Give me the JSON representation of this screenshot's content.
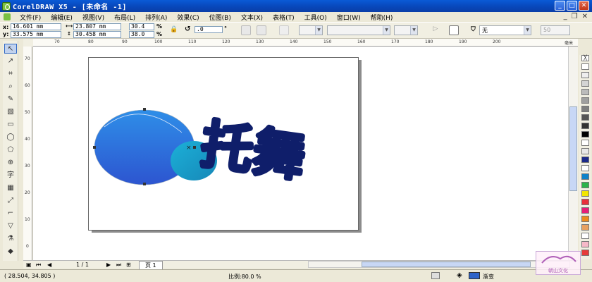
{
  "window": {
    "title": "CorelDRAW X5 - [未命名 -1]"
  },
  "window_controls": {
    "minimize": "_",
    "maximize": "□",
    "close": "✕"
  },
  "menu": [
    "文件(F)",
    "编辑(E)",
    "视图(V)",
    "布局(L)",
    "排列(A)",
    "效果(C)",
    "位图(B)",
    "文本(X)",
    "表格(T)",
    "工具(O)",
    "窗口(W)",
    "帮助(H)"
  ],
  "mdi_controls": {
    "minimize": "_",
    "restore": "❐",
    "close": "✕"
  },
  "property_bar": {
    "x_label": "x:",
    "x_value": "16.601 mm",
    "y_label": "y:",
    "y_value": "33.575 mm",
    "w_value": "23.807 mm",
    "h_value": "30.458 mm",
    "scale_x": "30.4",
    "scale_y": "38.0",
    "percent": "%",
    "rotation": ".0",
    "degree": "°",
    "fill_none": "无",
    "outline_value": "50"
  },
  "rulers": {
    "horizontal_ticks": [
      "70",
      "80",
      "90",
      "100",
      "110",
      "120",
      "130",
      "140",
      "150",
      "160",
      "170",
      "180",
      "190",
      "200"
    ],
    "horizontal_unit": "毫米",
    "vertical_ticks": [
      "70",
      "60",
      "50",
      "40",
      "30",
      "20",
      "10",
      "0"
    ]
  },
  "page_nav": {
    "current": "1 / 1",
    "tab_label": "页 1"
  },
  "status": {
    "coordinates": "( 28.504, 34.805 )",
    "zoom": "比例:80.0 %",
    "fill_type": "渐变"
  },
  "palette_colors": [
    "#ffffff",
    "#eeeeee",
    "#d4d4d4",
    "#bbbbbb",
    "#9f9f9f",
    "#7f7f7f",
    "#555555",
    "#333333",
    "#000000",
    "#ffffff",
    "#e8e8e8",
    "#1b2a8a",
    "#ffffff",
    "#0f82c8",
    "#2bb34a",
    "#f2e600",
    "#e8303a",
    "#e61e78",
    "#ec8a1d",
    "#e8a060",
    "#ffffff",
    "#f6b8c8",
    "#e63a3a"
  ],
  "colors": {
    "title_bar": "#0a5ad6",
    "circle_large": "#2f6de0",
    "circle_small": "#1aa6cc",
    "text_fill": "#0f1e6a"
  },
  "artwork": {
    "text": "托舞"
  },
  "watermark": {
    "text": "朝山文化"
  }
}
